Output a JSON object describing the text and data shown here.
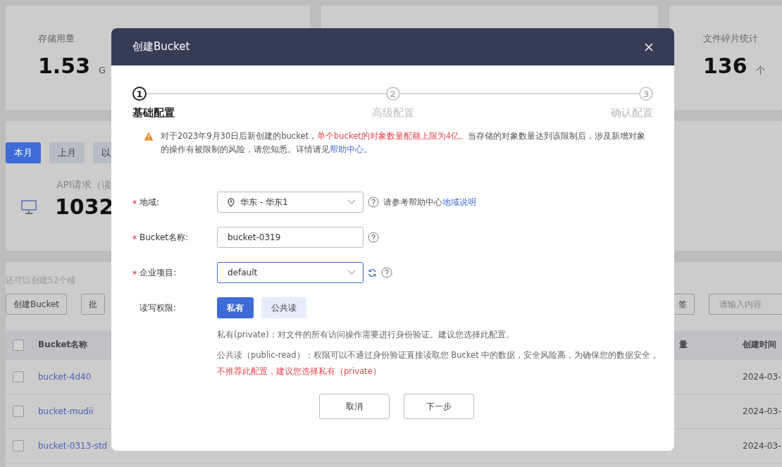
{
  "background": {
    "stats": [
      {
        "label": "存储用量",
        "value": "1.53",
        "unit": "G"
      },
      {
        "label": "文件碎片统计",
        "value": "136",
        "unit": "个"
      }
    ],
    "period_tabs": [
      {
        "label": "本月",
        "selected": true
      },
      {
        "label": "上月",
        "selected": false
      },
      {
        "label": "以",
        "selected": false
      }
    ],
    "api_stat": {
      "label": "API请求（读",
      "value": "1032"
    },
    "quota_note": "还可以创建52个桶",
    "buttons": [
      "创建Bucket",
      "批"
    ],
    "right_button": "签",
    "search": {
      "placeholder": "请输入内容"
    },
    "table": {
      "all_checked": false,
      "columns": [
        "Bucket名称",
        "量",
        "创建时间"
      ],
      "rows": [
        {
          "name": "bucket-4d40",
          "checked": false,
          "created": "2024-03-"
        },
        {
          "name": "bucket-mudii",
          "checked": false,
          "created": "2024-03-"
        },
        {
          "name": "bucket-0313-std",
          "checked": false,
          "created": "2024-03-"
        }
      ]
    }
  },
  "dialog": {
    "title": "创建Bucket",
    "steps": [
      {
        "number": "1",
        "label": "基础配置",
        "selected": true
      },
      {
        "number": "2",
        "label": "高级配置",
        "selected": false
      },
      {
        "number": "3",
        "label": "确认配置",
        "selected": false
      }
    ],
    "warning": [
      {
        "kind": "text",
        "text": "对于2023年9月30日后新创建的bucket，"
      },
      {
        "kind": "alert",
        "text": "单个bucket的对象数量配额上限为4亿。"
      },
      {
        "kind": "text",
        "text": "当存储的对象数量达到该限制后，涉及新增对象的操作有被限制的风险，请您知悉。详情请见"
      },
      {
        "kind": "link",
        "text": "帮助中心。"
      }
    ],
    "fields": [
      {
        "kind": "select",
        "label": "地域:",
        "required": true,
        "value": "华东 - 华东1",
        "focused": false,
        "hint": "请参考帮助中心",
        "hint_link": "地域说明"
      },
      {
        "kind": "input",
        "label": "Bucket名称:",
        "required": true,
        "value": "bucket-0319"
      },
      {
        "kind": "select",
        "label": "企业项目:",
        "required": true,
        "value": "default",
        "focused": true
      },
      {
        "kind": "options",
        "label": "读写权限:",
        "required": false,
        "options": [
          {
            "label": "私有",
            "selected": true
          },
          {
            "label": "公共读",
            "selected": false
          }
        ]
      }
    ],
    "descriptions": [
      [
        {
          "kind": "text",
          "text": "私有(private)：对文件的所有访问操作需要进行身份验证。建议您选择此配置。"
        }
      ],
      [
        {
          "kind": "text",
          "text": "公共读（public-read）：权限可以不通过身份验证直接读取您 Bucket 中的数据，安全风险高，为确保您的数据安全，"
        },
        {
          "kind": "alert",
          "text": "不推荐此配置，建议您选择私有（private）"
        }
      ]
    ],
    "buttons": [
      "取消",
      "下一步"
    ]
  }
}
